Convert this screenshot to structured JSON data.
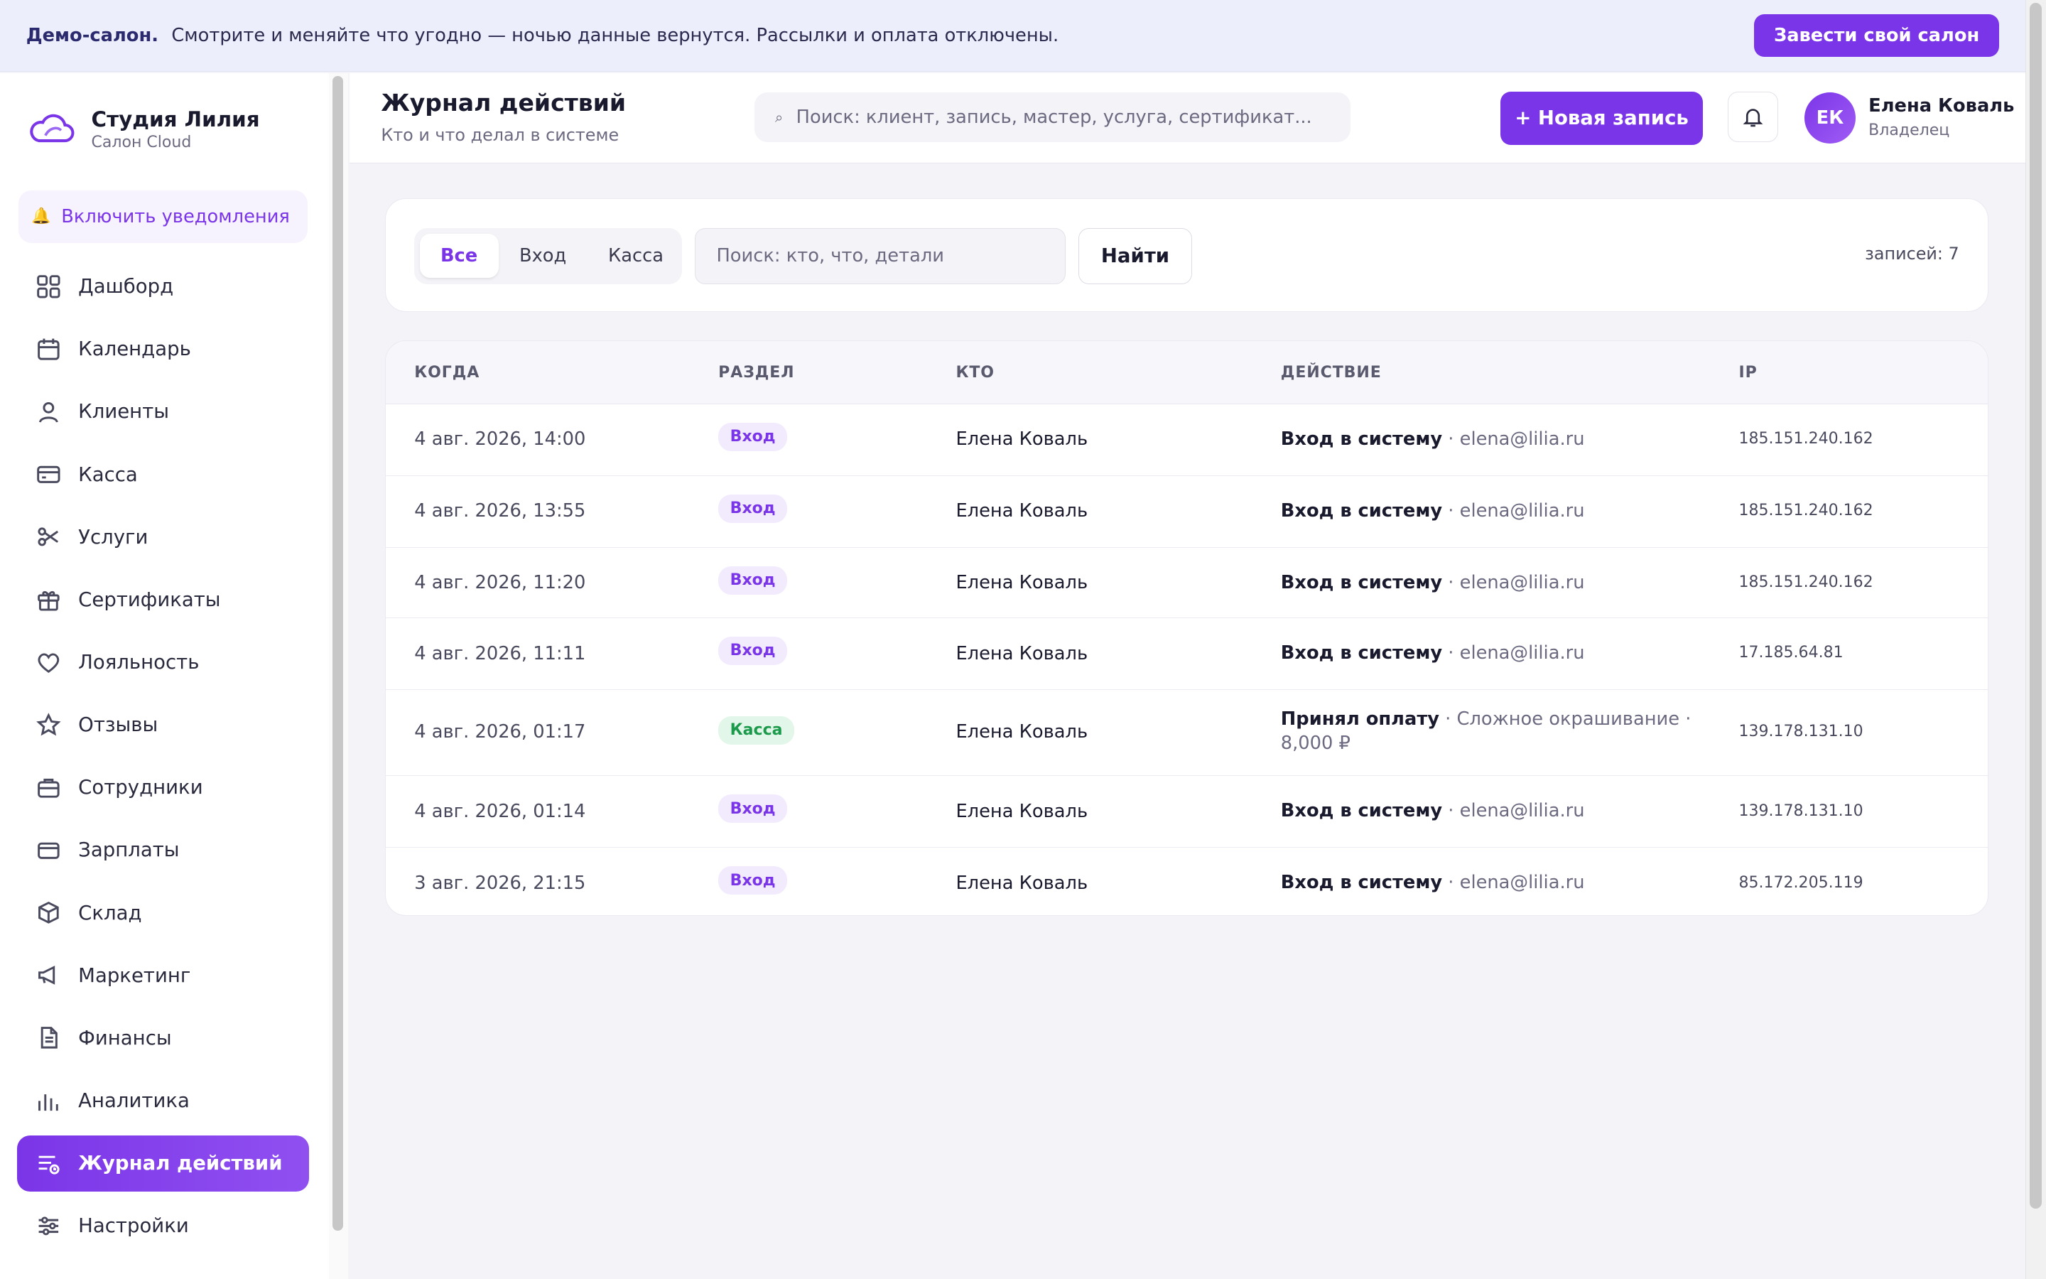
{
  "banner": {
    "strong": "Демо-салон.",
    "text": "Смотрите и меняйте что угодно — ночью данные вернутся. Рассылки и оплата отключены.",
    "button": "Завести свой салон"
  },
  "brand": {
    "name": "Студия Лилия",
    "sub": "Салон Cloud"
  },
  "notifications_label": "Включить уведомления",
  "nav": [
    {
      "label": "Дашборд",
      "icon": "dashboard-icon"
    },
    {
      "label": "Календарь",
      "icon": "calendar-icon"
    },
    {
      "label": "Клиенты",
      "icon": "user-icon"
    },
    {
      "label": "Касса",
      "icon": "card-icon"
    },
    {
      "label": "Услуги",
      "icon": "scissors-icon"
    },
    {
      "label": "Сертификаты",
      "icon": "gift-icon"
    },
    {
      "label": "Лояльность",
      "icon": "heart-icon"
    },
    {
      "label": "Отзывы",
      "icon": "star-icon"
    },
    {
      "label": "Сотрудники",
      "icon": "briefcase-icon"
    },
    {
      "label": "Зарплаты",
      "icon": "wallet-icon"
    },
    {
      "label": "Склад",
      "icon": "box-icon"
    },
    {
      "label": "Маркетинг",
      "icon": "megaphone-icon"
    },
    {
      "label": "Финансы",
      "icon": "document-icon"
    },
    {
      "label": "Аналитика",
      "icon": "bar-chart-icon"
    },
    {
      "label": "Журнал действий",
      "icon": "log-icon",
      "active": true
    },
    {
      "label": "Настройки",
      "icon": "sliders-icon"
    }
  ],
  "header": {
    "title": "Журнал действий",
    "subtitle": "Кто и что делал в системе",
    "search_placeholder": "Поиск: клиент, запись, мастер, услуга, сертификат...",
    "new_button": "+ Новая запись",
    "user_initials": "ЕК",
    "user_name": "Елена Коваль",
    "user_role": "Владелец"
  },
  "filters": {
    "tabs": [
      "Все",
      "Вход",
      "Касса"
    ],
    "active_tab": "Все",
    "search_placeholder": "Поиск: кто, что, детали",
    "find_button": "Найти",
    "count": "записей: 7"
  },
  "table": {
    "columns": [
      "КОГДА",
      "РАЗДЕЛ",
      "КТО",
      "ДЕЙСТВИЕ",
      "IP"
    ],
    "rows": [
      {
        "when": "4 авг. 2026, 14:00",
        "section": "Вход",
        "who": "Елена Коваль",
        "action": "Вход в систему",
        "details": "elena@lilia.ru",
        "ip": "185.151.240.162"
      },
      {
        "when": "4 авг. 2026, 13:55",
        "section": "Вход",
        "who": "Елена Коваль",
        "action": "Вход в систему",
        "details": "elena@lilia.ru",
        "ip": "185.151.240.162"
      },
      {
        "when": "4 авг. 2026, 11:20",
        "section": "Вход",
        "who": "Елена Коваль",
        "action": "Вход в систему",
        "details": "elena@lilia.ru",
        "ip": "185.151.240.162"
      },
      {
        "when": "4 авг. 2026, 11:11",
        "section": "Вход",
        "who": "Елена Коваль",
        "action": "Вход в систему",
        "details": "elena@lilia.ru",
        "ip": "17.185.64.81"
      },
      {
        "when": "4 авг. 2026, 01:17",
        "section": "Касса",
        "who": "Елена Коваль",
        "action": "Принял оплату",
        "details": "Сложное окрашивание · 8,000 ₽",
        "ip": "139.178.131.10"
      },
      {
        "when": "4 авг. 2026, 01:14",
        "section": "Вход",
        "who": "Елена Коваль",
        "action": "Вход в систему",
        "details": "elena@lilia.ru",
        "ip": "139.178.131.10"
      },
      {
        "when": "3 авг. 2026, 21:15",
        "section": "Вход",
        "who": "Елена Коваль",
        "action": "Вход в систему",
        "details": "elena@lilia.ru",
        "ip": "85.172.205.119"
      }
    ]
  },
  "colors": {
    "accent": "#7b35e8",
    "badge_login_bg": "#f1ebfd",
    "badge_cash_bg": "#e3f6ea",
    "badge_cash_text": "#1c9a4b"
  }
}
